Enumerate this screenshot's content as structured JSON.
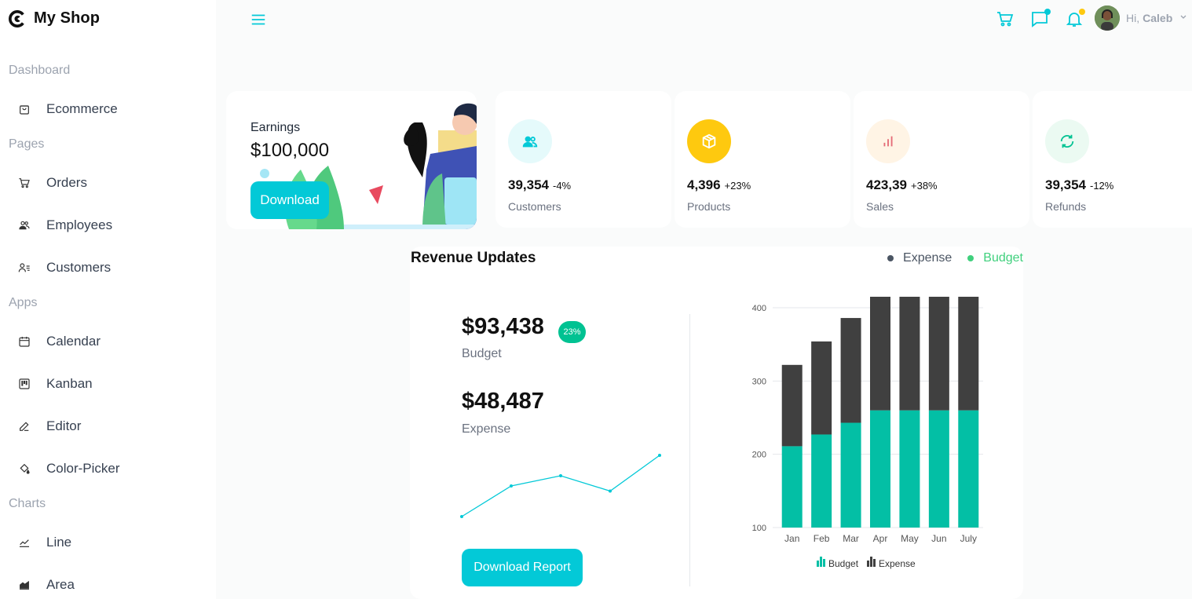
{
  "brand": {
    "name": "My Shop"
  },
  "sidebar": {
    "sections": [
      {
        "title": "Dashboard",
        "items": [
          {
            "label": "Ecommerce",
            "icon": "shopping-bag-icon"
          }
        ]
      },
      {
        "title": "Pages",
        "items": [
          {
            "label": "Orders",
            "icon": "cart-icon"
          },
          {
            "label": "Employees",
            "icon": "people-icon"
          },
          {
            "label": "Customers",
            "icon": "user-list-icon"
          }
        ]
      },
      {
        "title": "Apps",
        "items": [
          {
            "label": "Calendar",
            "icon": "calendar-icon"
          },
          {
            "label": "Kanban",
            "icon": "kanban-icon"
          },
          {
            "label": "Editor",
            "icon": "edit-icon"
          },
          {
            "label": "Color-Picker",
            "icon": "paint-bucket-icon"
          }
        ]
      },
      {
        "title": "Charts",
        "items": [
          {
            "label": "Line",
            "icon": "line-chart-icon"
          },
          {
            "label": "Area",
            "icon": "area-chart-icon"
          }
        ]
      }
    ]
  },
  "header": {
    "greeting": "Hi,",
    "user": "Caleb",
    "accent": "#03c9d7"
  },
  "earnings": {
    "label": "Earnings",
    "value": "$100,000",
    "button": "Download"
  },
  "stats": [
    {
      "value": "39,354",
      "change": "-4%",
      "label": "Customers",
      "icon": "users-icon",
      "icon_color": "#03c9d7",
      "bg": "#e5fafb",
      "change_color": "#1f2937"
    },
    {
      "value": "4,396",
      "change": "+23%",
      "label": "Products",
      "icon": "box-icon",
      "icon_color": "#ffffff",
      "bg": "#fec90f",
      "change_color": "#1f2937"
    },
    {
      "value": "423,39",
      "change": "+38%",
      "label": "Sales",
      "icon": "bar-chart-icon",
      "icon_color": "#e46a76",
      "bg": "#fff4e5",
      "change_color": "#1f2937"
    },
    {
      "value": "39,354",
      "change": "-12%",
      "label": "Refunds",
      "icon": "refresh-icon",
      "icon_color": "#00c292",
      "bg": "#ebfaf2",
      "change_color": "#1f2937"
    }
  ],
  "revenue": {
    "title": "Revenue Updates",
    "legend": [
      {
        "label": "Expense",
        "color": "#4b5563"
      },
      {
        "label": "Budget",
        "color": "#40d07d"
      }
    ],
    "budget": "$93,438",
    "budget_badge": "23%",
    "budget_label": "Budget",
    "expense": "$48,487",
    "expense_label": "Expense",
    "report_button": "Download Report"
  },
  "chart_data": {
    "type": "bar",
    "stacked": true,
    "categories": [
      "Jan",
      "Feb",
      "Mar",
      "Apr",
      "May",
      "Jun",
      "July"
    ],
    "series": [
      {
        "name": "Budget",
        "color": "#03bfa5",
        "values": [
          111,
          127,
          143,
          160,
          160,
          160,
          160
        ]
      },
      {
        "name": "Expense",
        "color": "#404040",
        "values": [
          111,
          127,
          143,
          160,
          160,
          160,
          160
        ]
      }
    ],
    "ylim": [
      100,
      400
    ],
    "yticks": [
      "100",
      "200",
      "300",
      "400"
    ],
    "legend": "bottom",
    "spark": {
      "values": [
        1,
        4,
        5,
        3.5,
        7
      ],
      "color": "#03c9d7"
    }
  }
}
